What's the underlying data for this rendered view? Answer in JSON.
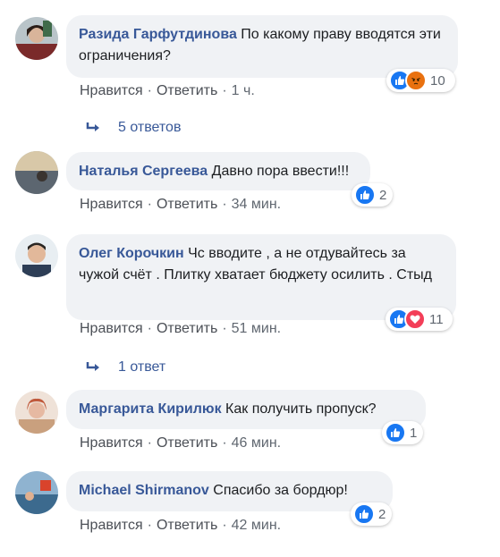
{
  "colors": {
    "author": "#385898",
    "bubble": "#f0f2f5",
    "like": "#1877f2",
    "love": "#f33e58",
    "angry": "#e9710f"
  },
  "labels": {
    "like": "Нравится",
    "reply": "Ответить",
    "separator": "·"
  },
  "comments": [
    {
      "author": "Разида Гарфутдинова",
      "text": "По какому праву вводятся эти ограничения?",
      "time": "1 ч.",
      "reactions": [
        "like-icon",
        "angry-icon"
      ],
      "reaction_count": "10",
      "replies": "5 ответов"
    },
    {
      "author": "Наталья Сергеева",
      "text": "Давно пора ввести!!!",
      "time": "34 мин.",
      "reactions": [
        "like-icon"
      ],
      "reaction_count": "2"
    },
    {
      "author": "Олег Корочкин",
      "text": "Чс вводите , а не отдувайтесь за чужой счёт . Плитку хватает бюджету осилить . Стыд",
      "time": "51 мин.",
      "reactions": [
        "like-icon",
        "love-icon"
      ],
      "reaction_count": "11",
      "replies": "1 ответ"
    },
    {
      "author": "Маргарита Кирилюк",
      "text": "Как получить пропуск?",
      "time": "46 мин.",
      "reactions": [
        "like-icon"
      ],
      "reaction_count": "1"
    },
    {
      "author": "Michael Shirmanov",
      "text": "Спасибо за бордюр!",
      "time": "42 мин.",
      "reactions": [
        "like-icon"
      ],
      "reaction_count": "2"
    }
  ]
}
